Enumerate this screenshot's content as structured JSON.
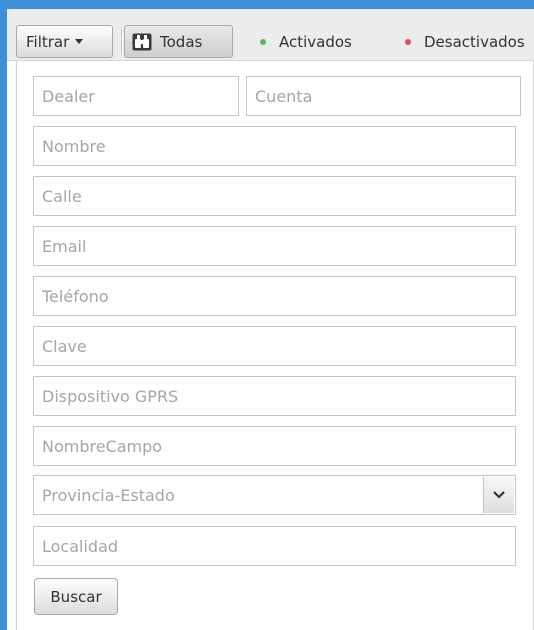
{
  "toolbar": {
    "filter_button_label": "Filtrar",
    "all_button_label": "Todas",
    "active_label": "Activados",
    "inactive_label": "Desactivados"
  },
  "form": {
    "dealer_placeholder": "Dealer",
    "cuenta_placeholder": "Cuenta",
    "nombre_placeholder": "Nombre",
    "calle_placeholder": "Calle",
    "email_placeholder": "Email",
    "telefono_placeholder": "Teléfono",
    "clave_placeholder": "Clave",
    "dispositivo_placeholder": "Dispositivo GPRS",
    "nombrecampo_placeholder": "NombreCampo",
    "provincia_selected": "Provincia-Estado",
    "localidad_placeholder": "Localidad",
    "search_button_label": "Buscar"
  },
  "colors": {
    "accent_border": "#3d8fd8",
    "active_dot": "#5cb85c",
    "inactive_dot": "#e0505a"
  },
  "icons": {
    "all_filter": "binoculars-icon",
    "active_status": "green-dot-icon",
    "inactive_status": "red-dot-icon",
    "select_toggle": "chevron-down-icon"
  }
}
